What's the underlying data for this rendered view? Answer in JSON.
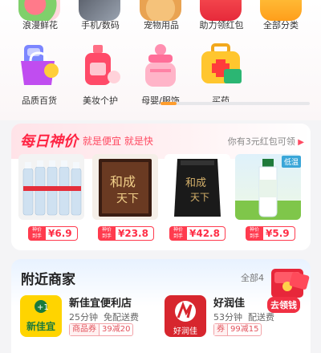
{
  "categories_row1": [
    {
      "label": "浪漫鲜花",
      "icon": "flower-icon"
    },
    {
      "label": "手机/数码",
      "icon": "phone-icon"
    },
    {
      "label": "宠物用品",
      "icon": "pet-icon"
    },
    {
      "label": "助力领红包",
      "icon": "red-packet-icon"
    },
    {
      "label": "全部分类",
      "icon": "all-categories-icon"
    }
  ],
  "categories_row2": [
    {
      "label": "品质百货",
      "icon": "shopping-bag-icon"
    },
    {
      "label": "美妆个护",
      "icon": "cosmetics-icon"
    },
    {
      "label": "母婴/服饰",
      "icon": "baby-bottle-icon"
    },
    {
      "label": "买药",
      "icon": "medicine-box-icon"
    }
  ],
  "daily": {
    "title": "每日神价",
    "subtitle": "就是便宜 就是快",
    "coupon_hint": "你有3元红包可领",
    "products": [
      {
        "name": "矿泉水整箱",
        "badge": "",
        "tag_top": "神价",
        "tag_bottom": "到手",
        "price": "¥6.9"
      },
      {
        "name": "和成天下白酒礼盒",
        "badge": "",
        "tag_top": "神价",
        "tag_bottom": "到手",
        "price": "¥23.8"
      },
      {
        "name": "和成天下袋装",
        "badge": "",
        "tag_top": "神价",
        "tag_bottom": "到手",
        "price": "¥42.8"
      },
      {
        "name": "牛奶",
        "badge": "低温",
        "tag_top": "神价",
        "tag_bottom": "到手",
        "price": "¥5.9"
      }
    ]
  },
  "nearby": {
    "title": "附近商家",
    "all_label": "全部4",
    "promo_label": "去领钱",
    "stores": [
      {
        "logo_text": "新佳宜",
        "name": "新佳宜便利店",
        "meta": "25分钟  免配送费",
        "tag_a": "商品券",
        "tag_b": "39减20"
      },
      {
        "logo_text": "好润佳",
        "name": "好润佳",
        "meta": "53分钟  配送费",
        "tag_a": "券",
        "tag_b": "99减15"
      }
    ]
  },
  "colors": {
    "accent": "#ff3b4e",
    "scroll_accent": "#ff9d2d"
  }
}
